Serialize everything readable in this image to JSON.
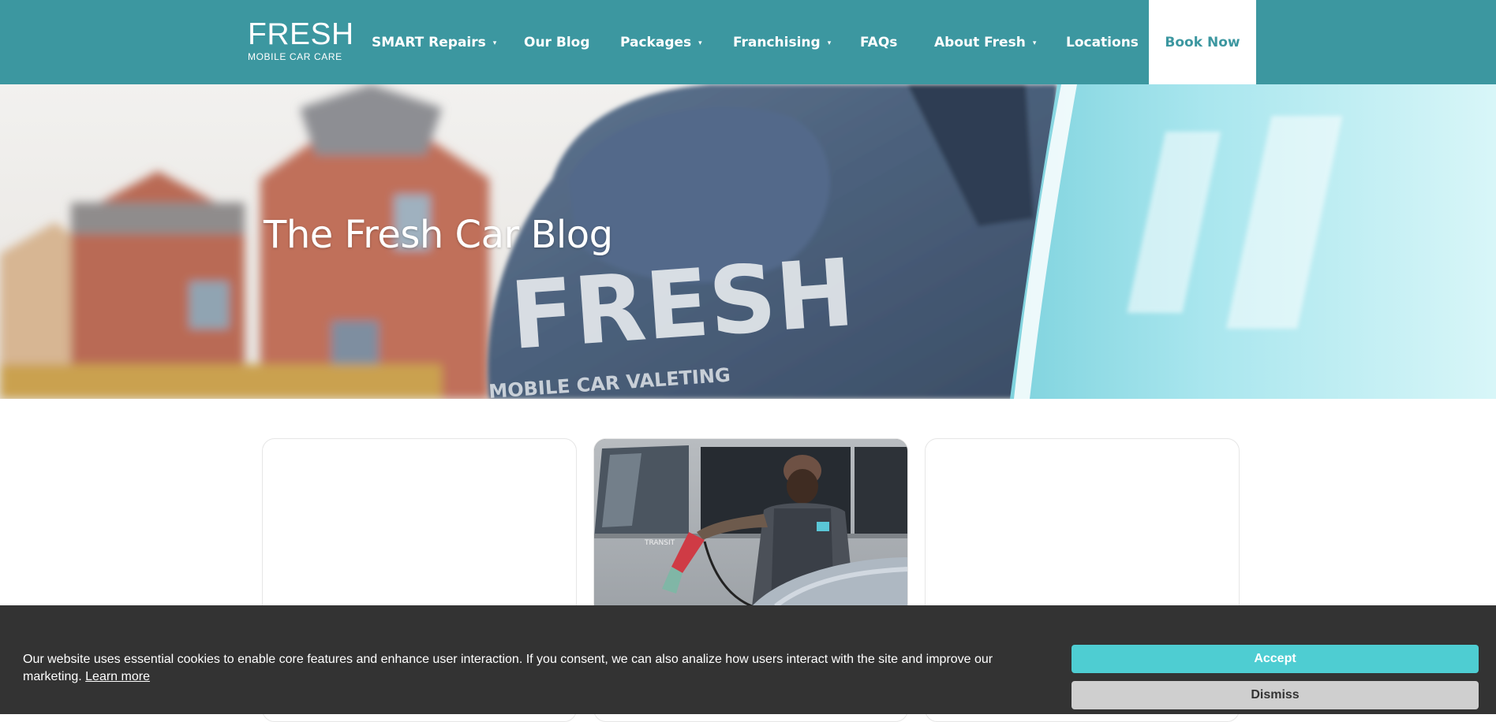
{
  "header": {
    "logo_main": "FRESH",
    "logo_sub": "MOBILE CAR CARE",
    "nav": [
      {
        "label": "SMART Repairs",
        "caret": "▾"
      },
      {
        "label": "Our Blog"
      },
      {
        "label": "Packages",
        "caret": "▾"
      },
      {
        "label": "Franchising",
        "caret": "▾"
      },
      {
        "label": "FAQs"
      },
      {
        "label": "About Fresh",
        "caret": "▾"
      },
      {
        "label": "Locations"
      }
    ],
    "book_now": "Book Now"
  },
  "hero": {
    "title": "The Fresh Car Blog",
    "hoodie_print": "FRESH",
    "hoodie_sub": "MOBILE CAR VALETING"
  },
  "cards": {
    "photo_van_badge": "TRANSIT"
  },
  "cookie": {
    "text": "Our website uses essential cookies to enable core features and enhance user interaction. If you consent, we can also analize how users interact with the site and improve our marketing.",
    "learn_more": "Learn more",
    "accept": "Accept",
    "dismiss": "Dismiss"
  },
  "colors": {
    "brand_teal": "#3c97a0",
    "accept_button": "#4ecdd2",
    "cookie_bg": "#333333"
  }
}
